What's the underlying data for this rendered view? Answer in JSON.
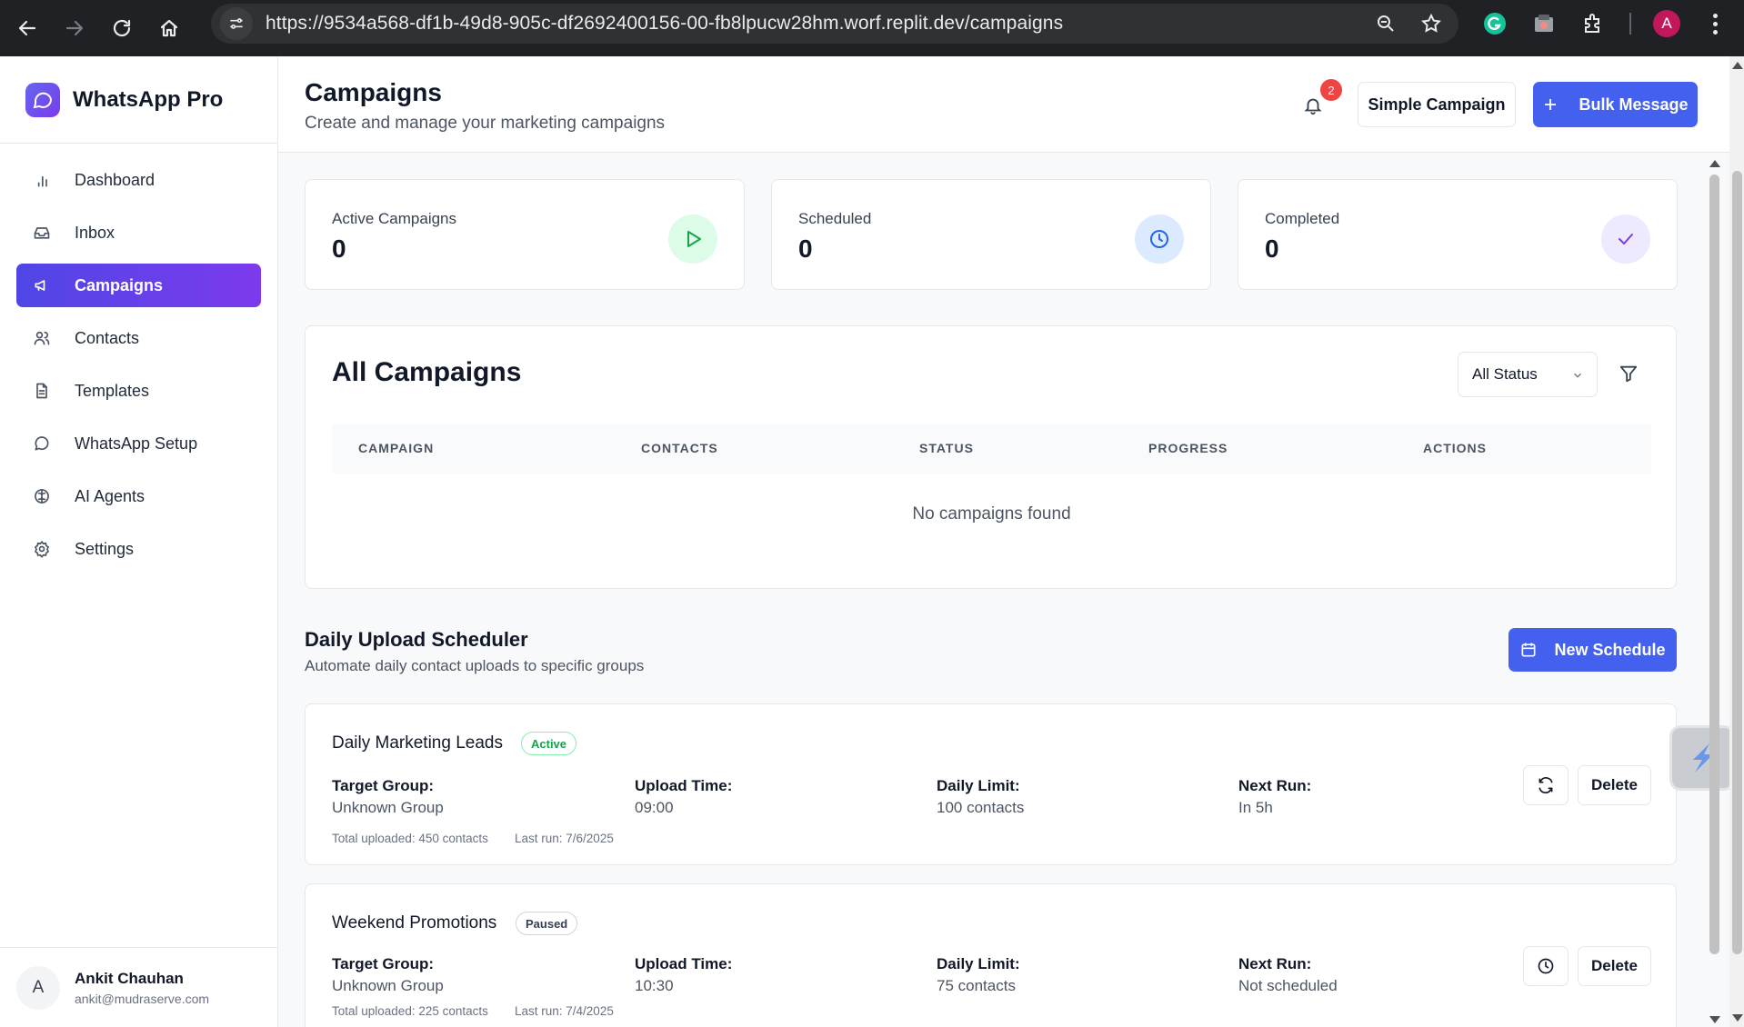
{
  "browser": {
    "url": "https://9534a568-df1b-49d8-905c-df2692400156-00-fb8lpucw28hm.worf.replit.dev/campaigns",
    "profile_initial": "A"
  },
  "brand": {
    "name": "WhatsApp Pro"
  },
  "sidebar": {
    "items": [
      {
        "label": "Dashboard",
        "icon": "bar-chart-icon"
      },
      {
        "label": "Inbox",
        "icon": "inbox-icon"
      },
      {
        "label": "Campaigns",
        "icon": "megaphone-icon",
        "active": true
      },
      {
        "label": "Contacts",
        "icon": "users-icon"
      },
      {
        "label": "Templates",
        "icon": "file-text-icon"
      },
      {
        "label": "WhatsApp Setup",
        "icon": "message-circle-icon"
      },
      {
        "label": "AI Agents",
        "icon": "brain-icon"
      },
      {
        "label": "Settings",
        "icon": "gear-icon"
      }
    ],
    "user": {
      "initial": "A",
      "name": "Ankit Chauhan",
      "email": "ankit@mudraserve.com"
    }
  },
  "header": {
    "title": "Campaigns",
    "subtitle": "Create and manage your marketing campaigns",
    "notification_count": "2",
    "simple_campaign_label": "Simple Campaign",
    "bulk_message_label": "Bulk Message"
  },
  "stats": [
    {
      "label": "Active Campaigns",
      "value": "0",
      "icon": "play-icon",
      "color": "#16a34a",
      "bg": "#dcfce7"
    },
    {
      "label": "Scheduled",
      "value": "0",
      "icon": "clock-icon",
      "color": "#2563eb",
      "bg": "#dbeafe"
    },
    {
      "label": "Completed",
      "value": "0",
      "icon": "check-icon",
      "color": "#7c3aed",
      "bg": "#ede9fe"
    }
  ],
  "campaigns": {
    "title": "All Campaigns",
    "status_filter": "All Status",
    "columns": [
      "CAMPAIGN",
      "CONTACTS",
      "STATUS",
      "PROGRESS",
      "ACTIONS"
    ],
    "empty_text": "No campaigns found"
  },
  "scheduler": {
    "title": "Daily Upload Scheduler",
    "subtitle": "Automate daily contact uploads to specific groups",
    "new_label": "New Schedule",
    "field_labels": {
      "target_group": "Target Group:",
      "upload_time": "Upload Time:",
      "daily_limit": "Daily Limit:",
      "next_run": "Next Run:"
    },
    "delete_label": "Delete",
    "items": [
      {
        "name": "Daily Marketing Leads",
        "status": "Active",
        "target_group": "Unknown Group",
        "upload_time": "09:00",
        "daily_limit": "100 contacts",
        "next_run": "In 5h",
        "total_uploaded": "Total uploaded: 450 contacts",
        "last_run": "Last run: 7/6/2025",
        "action_icon": "refresh-icon"
      },
      {
        "name": "Weekend Promotions",
        "status": "Paused",
        "target_group": "Unknown Group",
        "upload_time": "10:30",
        "daily_limit": "75 contacts",
        "next_run": "Not scheduled",
        "total_uploaded": "Total uploaded: 225 contacts",
        "last_run": "Last run: 7/4/2025",
        "action_icon": "clock-icon"
      }
    ]
  },
  "colors": {
    "primary": "#4361ee",
    "active_gradient_start": "#4f46e5",
    "active_gradient_end": "#7c3aed"
  }
}
